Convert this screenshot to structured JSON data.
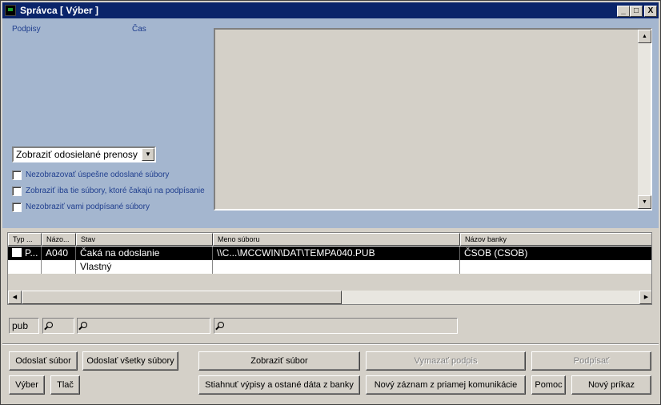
{
  "window": {
    "title": "Správca  [ Výber ]",
    "minimize": "_",
    "maximize": "□",
    "close": "X"
  },
  "upper": {
    "signatures_label": "Podpisy",
    "time_label": "Čas",
    "filter_combo_value": "Zobraziť odosielané prenosy",
    "checkboxes": [
      "Nezobrazovať úspešne odoslané súbory",
      "Zobraziť iba tie súbory, ktoré čakajú na podpísanie",
      "Nezobraziť vami podpísané súbory"
    ]
  },
  "grid": {
    "columns": [
      "Typ ...",
      "Názo...",
      "Stav",
      "Meno súboru",
      "Názov banky"
    ],
    "rows": [
      {
        "type": "P...",
        "name": "A040",
        "status": "Čaká na odoslanie",
        "file": "\\\\C...\\MCCWIN\\DAT\\TEMPA040.PUB",
        "bank": "ČSOB (CSOB)"
      },
      {
        "type": "",
        "name": "",
        "status": "Vlastný",
        "file": "",
        "bank": ""
      }
    ]
  },
  "search": {
    "ext_value": "pub"
  },
  "buttons": {
    "send_file": "Odoslať súbor",
    "send_all": "Odoslať všetky súbory",
    "show_file": "Zobraziť súbor",
    "delete_signature": "Vymazať podpis",
    "sign": "Podpísať",
    "select": "Výber",
    "print": "Tlač",
    "download": "Stiahnuť výpisy a ostané dáta z banky",
    "new_record": "Nový záznam z priamej komunikácie",
    "help": "Pomoc",
    "new_order": "Nový príkaz"
  }
}
